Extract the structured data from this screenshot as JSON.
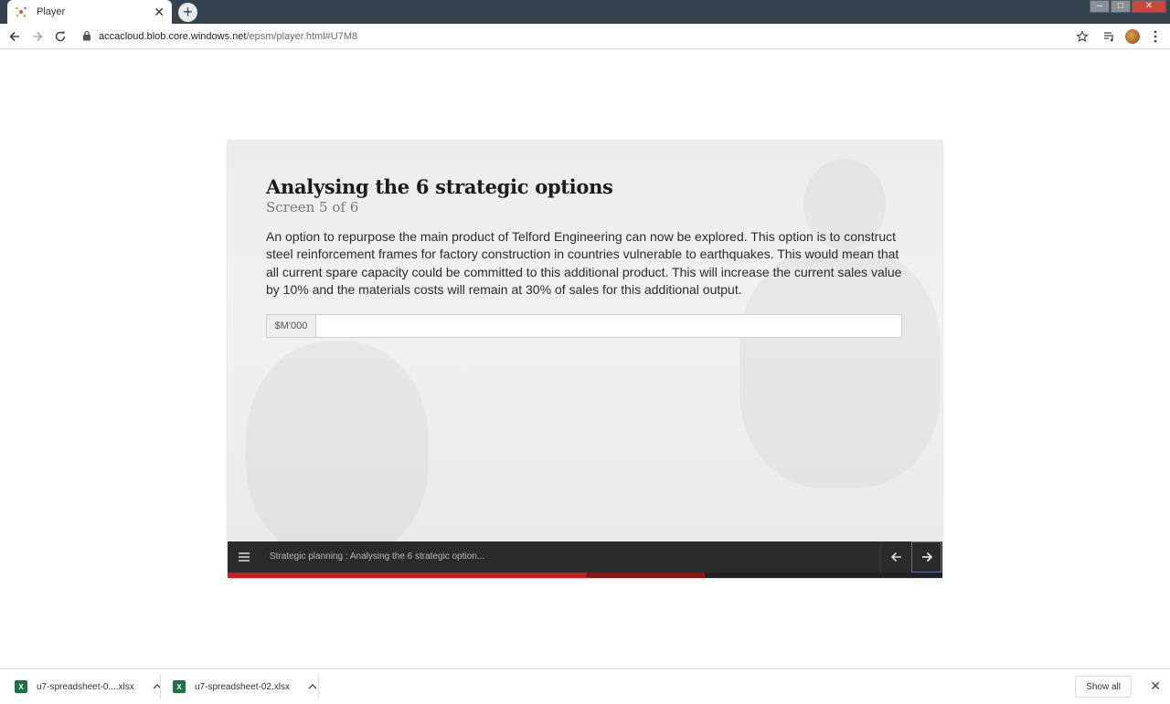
{
  "browser": {
    "tab_title": "Player",
    "tab_close": "✕",
    "new_tab": "+",
    "url_host": "accacloud.blob.core.windows.net",
    "url_path": "/epsm/player.html#U7M8"
  },
  "slide": {
    "title": "Analysing the 6 strategic options",
    "subtitle": "Screen 5 of 6",
    "body": "An option to repurpose the main product of Telford Engineering can now be explored. This option is to construct steel reinforcement frames for factory construction in countries vulnerable to earthquakes. This would mean that all current spare capacity could be committed to this additional product. This will increase the current sales value by 10% and the materials costs will remain at 30% of sales for this additional output.",
    "input_addon": "$M'000",
    "input_value": ""
  },
  "player_bar": {
    "breadcrumb": "Strategic planning : Analysing the 6 strategic option...",
    "progress_played": 0.502,
    "progress_buffered": 0.668
  },
  "downloads": {
    "items": [
      {
        "name": "u7-spreadsheet-0....xlsx"
      },
      {
        "name": "u7-spreadsheet-02.xlsx"
      }
    ],
    "show_all": "Show all",
    "close": "✕"
  },
  "icons": {
    "back": "arrow-left-icon",
    "forward": "arrow-right-icon",
    "reload": "reload-icon",
    "lock": "lock-icon",
    "star": "star-icon",
    "media": "media-control-icon",
    "menu": "hamburger-menu-icon",
    "prev": "previous-arrow-icon",
    "next": "next-arrow-icon",
    "excel": "excel-file-icon",
    "caret": "chevron-up-icon"
  }
}
